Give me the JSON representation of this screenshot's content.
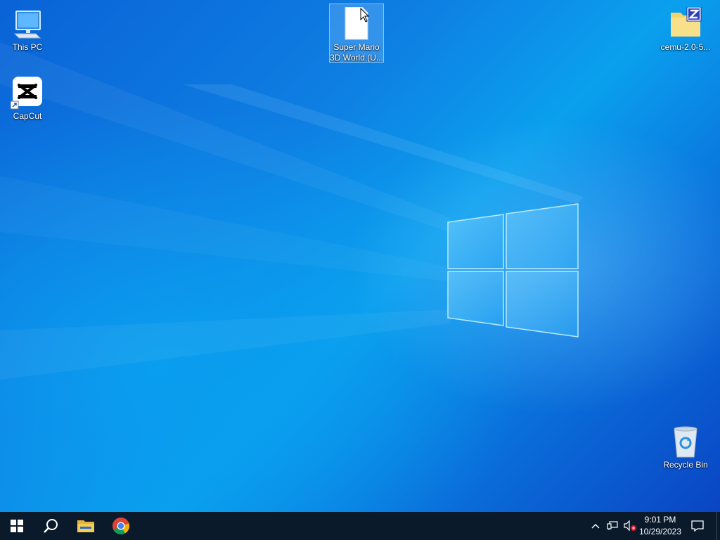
{
  "desktop": {
    "icons": [
      {
        "label": "This PC"
      },
      {
        "label": "CapCut"
      },
      {
        "label": "Super Mario 3D World (U..."
      },
      {
        "label": "cemu-2.0-5..."
      },
      {
        "label": "Recycle Bin"
      }
    ]
  },
  "taskbar": {
    "start": "start-icon",
    "search": "search-icon",
    "file_explorer": "folder-icon",
    "chrome": "chrome-icon",
    "tray": [
      "chevron-up-icon",
      "network-icon",
      "volume-muted-icon",
      "notification-icon"
    ]
  },
  "clock": {
    "time": "9:01 PM",
    "date": "10/29/2023"
  },
  "colors": {
    "taskbar": "#0b1a2b",
    "desktop_accent": "#0a78e0"
  }
}
